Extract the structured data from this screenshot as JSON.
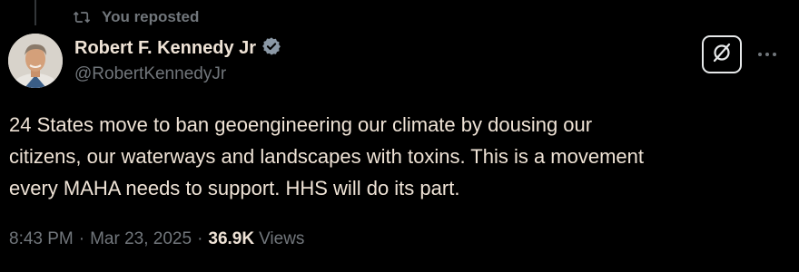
{
  "repost": {
    "label": "You reposted",
    "icon": "repost-icon"
  },
  "author": {
    "display_name": "Robert F. Kennedy Jr",
    "handle": "@RobertKennedyJr",
    "verified_icon": "verified-badge-icon",
    "verified_color": "#8b98a5"
  },
  "actions": {
    "grok_icon": "grok-icon",
    "more_icon": "more-options-icon"
  },
  "tweet": {
    "text": "24 States move to ban geoengineering our climate by dousing our\ncitizens, our waterways and landscapes with toxins. This is a movement\nevery MAHA needs to support. HHS will do its part."
  },
  "meta": {
    "time": "8:43 PM",
    "separator": "·",
    "date": "Mar 23, 2025",
    "views_count": "36.9K",
    "views_label": "Views"
  },
  "colors": {
    "background": "#000000",
    "text": "#efe3d6",
    "muted": "#71767b"
  }
}
